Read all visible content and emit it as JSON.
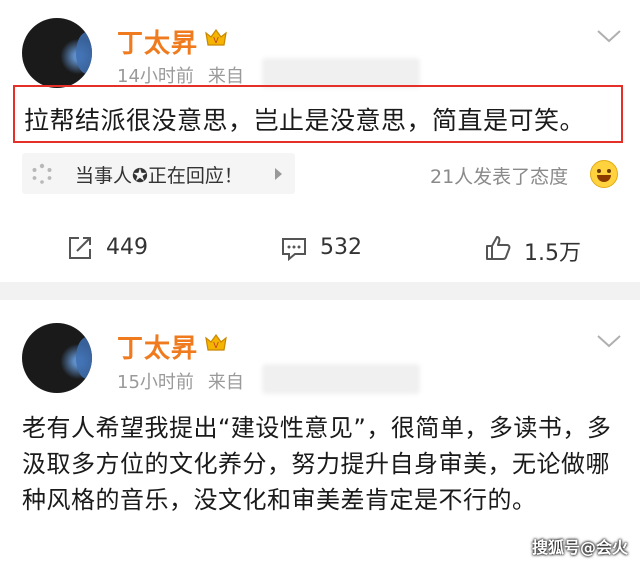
{
  "posts": [
    {
      "author": "丁太昇",
      "time": "14小时前",
      "source_prefix": "来自",
      "text": "拉帮结派很没意思，岂止是没意思，简直是可笑。",
      "card_label": "当事人✪正在回应！",
      "reactions_text": "21人发表了态度",
      "actions": {
        "repost": "449",
        "comment": "532",
        "like": "1.5万"
      }
    },
    {
      "author": "丁太昇",
      "time": "15小时前",
      "source_prefix": "来自",
      "text": "老有人希望我提出“建设性意见”，很简单，多读书，多汲取多方位的文化养分，努力提升自身审美，无论做哪种风格的音乐，没文化和审美差肯定是不行的。"
    }
  ],
  "watermark": "搜狐号@会火",
  "colors": {
    "author_name": "#f07b1e",
    "highlight_border": "#e5302a",
    "crown_badge": "#e8a400"
  },
  "icons": [
    "avatar",
    "crown-badge-icon",
    "chevron-down-icon",
    "loading-spinner-icon",
    "arrow-right-icon",
    "laugh-emoji-icon",
    "repost-icon",
    "comment-icon",
    "like-icon"
  ]
}
